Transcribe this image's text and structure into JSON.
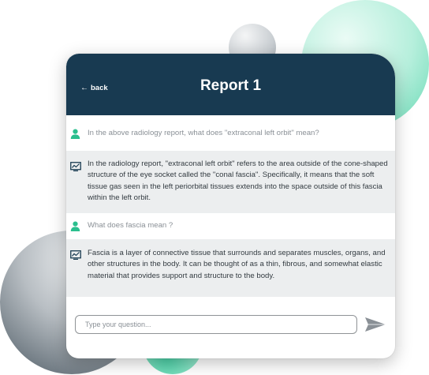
{
  "header": {
    "back_label": "back",
    "title": "Report 1",
    "background_color": "#183a51"
  },
  "conversation": [
    {
      "role": "user",
      "icon": "user-icon",
      "text": "In the above radiology report, what does \"extraconal left orbit\" mean?"
    },
    {
      "role": "assistant",
      "icon": "chart-monitor-icon",
      "text": "In the radiology report, \"extraconal left orbit\" refers to the area outside of the cone-shaped structure of the eye socket called the \"conal fascia\". Specifically, it means that the soft tissue gas seen in the left periorbital tissues extends into the space outside of this fascia within the left orbit."
    },
    {
      "role": "user",
      "icon": "user-icon",
      "text": "What does fascia mean ?"
    },
    {
      "role": "assistant",
      "icon": "chart-monitor-icon",
      "text": "Fascia is a layer of connective tissue that surrounds and separates muscles, organs, and other structures in the body. It can be thought of as a thin, fibrous, and somewhat elastic material that provides support and structure to the body."
    }
  ],
  "composer": {
    "placeholder": "Type your question...",
    "value": "",
    "send_icon": "send-icon"
  },
  "colors": {
    "accent_teal": "#2bbf8e",
    "answer_background": "#eceeef",
    "question_text": "#8a9096",
    "answer_text": "#333b41"
  }
}
